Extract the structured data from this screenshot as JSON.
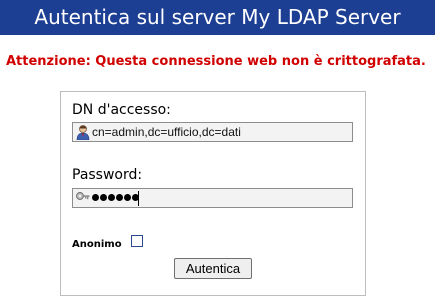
{
  "header": {
    "title": "Autentica sul server My LDAP Server"
  },
  "warning": {
    "text": "Attenzione: Questa connessione web non è crittografata."
  },
  "login": {
    "dn_label": "DN d'accesso:",
    "dn_value": "cn=admin,dc=ufficio,dc=dati",
    "dn_icon": "user-icon",
    "password_label": "Password:",
    "password_icon": "key-icon",
    "password_masked_length": 6,
    "anonymous_label": "Anonimo",
    "anonymous_checked": false,
    "submit_label": "Autentica"
  },
  "colors": {
    "header_bg": "#1c3e93",
    "warning_text": "#d10000"
  }
}
